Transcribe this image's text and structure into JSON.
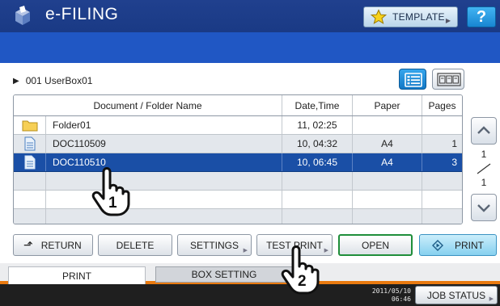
{
  "window": {
    "app_title": "e-FILING",
    "template_label": "TEMPLATE",
    "help_label": "?"
  },
  "location": {
    "box_name": "001 UserBox01"
  },
  "table": {
    "columns": [
      "Document / Folder Name",
      "Date,Time",
      "Paper",
      "Pages"
    ],
    "rows": [
      {
        "type": "folder",
        "name": "Folder01",
        "date": "11, 02:25",
        "paper": "",
        "pages": ""
      },
      {
        "type": "document",
        "name": "DOC110509",
        "date": "10, 04:32",
        "paper": "A4",
        "pages": "1"
      },
      {
        "type": "document",
        "name": "DOC110510",
        "date": "10, 06:45",
        "paper": "A4",
        "pages": "3",
        "selected": true
      }
    ]
  },
  "pagination": {
    "current": "1",
    "total": "1"
  },
  "actions": {
    "return": "RETURN",
    "delete": "DELETE",
    "settings": "SETTINGS",
    "test_print": "TEST PRINT",
    "open": "OPEN",
    "print": "PRINT"
  },
  "tabs": {
    "print": "PRINT",
    "box_setting": "BOX SETTING"
  },
  "status": {
    "date": "2011/05/10",
    "time": "06:46",
    "job_status": "JOB STATUS"
  },
  "annotations": {
    "step_1": "1",
    "step_2": "2"
  },
  "icons": {
    "app": "efiling-box-icon",
    "template": "star-icon",
    "folder": "folder-icon",
    "document": "document-icon",
    "list_view": "list-view-icon",
    "thumbnail_view": "thumbnail-view-icon"
  },
  "colors": {
    "title_bar": "#1a3a85",
    "info_band": "#2057c4",
    "selected_row": "#1a4fa6",
    "tab_accent": "#e97a10",
    "open_border": "#1f8e3a"
  }
}
